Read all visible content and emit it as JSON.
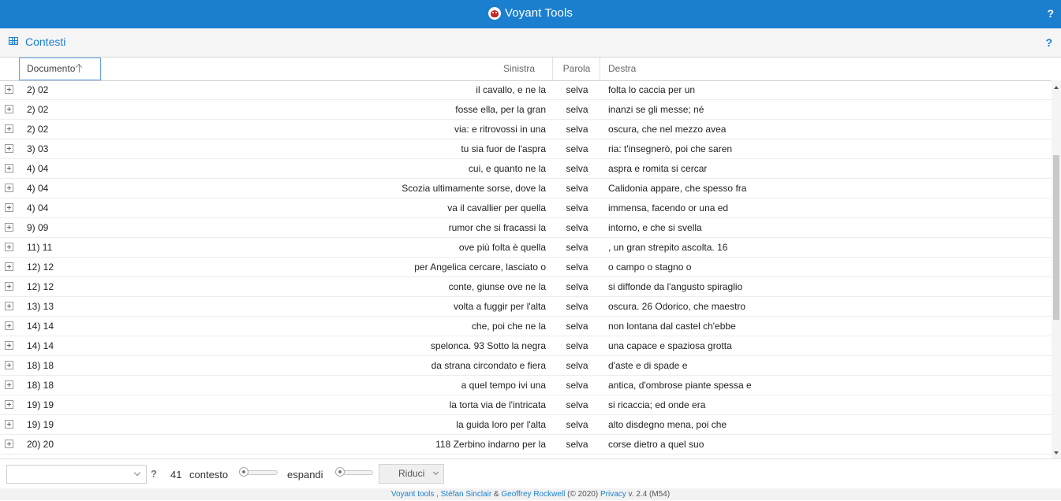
{
  "app": {
    "title": "Voyant Tools",
    "help": "?"
  },
  "panel": {
    "title": "Contesti",
    "help": "?"
  },
  "columns": {
    "documento": "Documento",
    "sinistra": "Sinistra",
    "parola": "Parola",
    "destra": "Destra"
  },
  "rows": [
    {
      "doc": "2) 02",
      "left": "il cavallo, e ne la",
      "term": "selva",
      "right": "folta lo caccia per un"
    },
    {
      "doc": "2) 02",
      "left": "fosse ella, per la gran",
      "term": "selva",
      "right": "inanzi se gli messe; né"
    },
    {
      "doc": "2) 02",
      "left": "via: e ritrovossi in una",
      "term": "selva",
      "right": "oscura, che nel mezzo avea"
    },
    {
      "doc": "3) 03",
      "left": "tu sia fuor de l'aspra",
      "term": "selva",
      "right": "ria: t'insegnerò, poi che saren"
    },
    {
      "doc": "4) 04",
      "left": "cui, e quanto ne la",
      "term": "selva",
      "right": "aspra e romita si cercar"
    },
    {
      "doc": "4) 04",
      "left": "Scozia ultimamente sorse, dove la",
      "term": "selva",
      "right": "Calidonia appare, che spesso fra"
    },
    {
      "doc": "4) 04",
      "left": "va il cavallier per quella",
      "term": "selva",
      "right": "immensa, facendo or una ed"
    },
    {
      "doc": "9) 09",
      "left": "rumor che si fracassi la",
      "term": "selva",
      "right": "intorno, e che si svella"
    },
    {
      "doc": "11) 11",
      "left": "ove più folta è quella",
      "term": "selva",
      "right": ", un gran strepito ascolta. 16"
    },
    {
      "doc": "12) 12",
      "left": "per Angelica cercare, lasciato o",
      "term": "selva",
      "right": "o campo o stagno o"
    },
    {
      "doc": "12) 12",
      "left": "conte, giunse ove ne la",
      "term": "selva",
      "right": "si diffonde da l'angusto spiraglio"
    },
    {
      "doc": "13) 13",
      "left": "volta a fuggir per l'alta",
      "term": "selva",
      "right": "oscura. 26 Odorico, che maestro"
    },
    {
      "doc": "14) 14",
      "left": "che, poi che ne la",
      "term": "selva",
      "right": "non lontana dal castel ch'ebbe"
    },
    {
      "doc": "14) 14",
      "left": "spelonca. 93 Sotto la negra",
      "term": "selva",
      "right": "una capace e spaziosa grotta"
    },
    {
      "doc": "18) 18",
      "left": "da strana circondato e fiera",
      "term": "selva",
      "right": "d'aste e di spade e"
    },
    {
      "doc": "18) 18",
      "left": "a quel tempo ivi una",
      "term": "selva",
      "right": "antica, d'ombrose piante spessa e"
    },
    {
      "doc": "19) 19",
      "left": "la torta via de l'intricata",
      "term": "selva",
      "right": "si ricaccia; ed onde era"
    },
    {
      "doc": "19) 19",
      "left": "la guida loro per l'alta",
      "term": "selva",
      "right": "alto disdegno mena, poi che"
    },
    {
      "doc": "20) 20",
      "left": "118 Zerbino indarno per la",
      "term": "selva",
      "right": "corse dietro a quel suo"
    }
  ],
  "toolbar": {
    "search_value": "",
    "help": "?",
    "count": "41",
    "context_label": "contesto",
    "context_value": 0,
    "expand_label": "espandi",
    "expand_value": 0,
    "reduce_label": "Riduci"
  },
  "footer": {
    "link_voyant": "Voyant tools",
    "sep1": " , ",
    "link_sinclair": "Stéfan Sinclair",
    "amp": " & ",
    "link_rockwell": "Geoffrey Rockwell",
    "copyright": " (© 2020) ",
    "link_privacy": "Privacy",
    "version": " v. 2.4 (M54)"
  }
}
